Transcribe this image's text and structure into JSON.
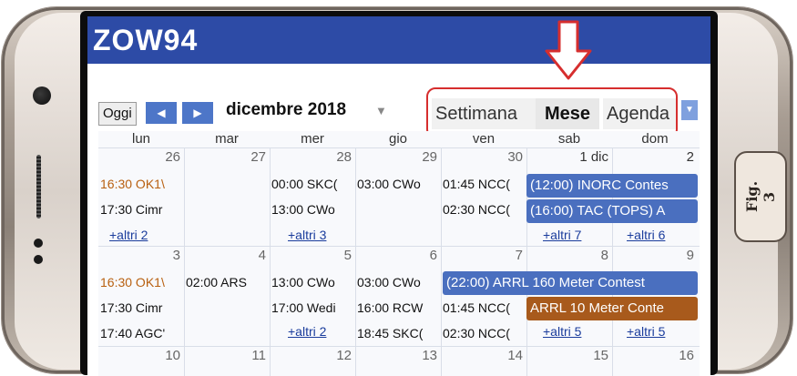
{
  "app": {
    "title": "ZOW94"
  },
  "toolbar": {
    "today_label": "Oggi",
    "prev_label": "◀",
    "next_label": "▶",
    "month_label": "dicembre 2018",
    "views": [
      {
        "label": "Settimana",
        "active": false
      },
      {
        "label": "Mese",
        "active": true
      },
      {
        "label": "Agenda",
        "active": false
      }
    ]
  },
  "weekdays": [
    "lun",
    "mar",
    "mer",
    "gio",
    "ven",
    "sab",
    "dom"
  ],
  "weeks": [
    {
      "days": [
        "26",
        "27",
        "28",
        "29",
        "30",
        "1 dic",
        "2"
      ],
      "events": [
        [
          "16:30 OK1\\",
          "",
          "00:00 SKC(",
          "03:00 CWo",
          "01:45 NCC(",
          "",
          ""
        ],
        [
          "17:30 Cimr",
          "",
          "13:00 CWo",
          "",
          "02:30 NCC(",
          "",
          ""
        ]
      ],
      "more": [
        "+altri 2",
        "",
        "+altri 3",
        "",
        "",
        "+altri 7",
        "+altri 6"
      ],
      "bars": [
        {
          "text": "(12:00) INORC Contes",
          "color": "#4a6fbf"
        },
        {
          "text": "(16:00) TAC (TOPS) A",
          "color": "#4a6fbf"
        }
      ]
    },
    {
      "days": [
        "3",
        "4",
        "5",
        "6",
        "7",
        "8",
        "9"
      ],
      "events": [
        [
          "16:30 OK1\\",
          "02:00 ARS",
          "13:00 CWo",
          "03:00 CWo",
          "",
          "",
          ""
        ],
        [
          "17:30 Cimr",
          "",
          "17:00 Wedi",
          "16:00 RCW",
          "01:45 NCC(",
          "",
          ""
        ],
        [
          "17:40 AGC'",
          "",
          "",
          "18:45 SKC(",
          "02:30 NCC(",
          "",
          ""
        ]
      ],
      "more": [
        "",
        "",
        "+altri 2",
        "",
        "",
        "+altri 5",
        "+altri 5"
      ],
      "bars": [
        {
          "text": "(22:00) ARRL 160 Meter Contest",
          "color": "#4a6fbf"
        },
        {
          "text": "ARRL 10 Meter Conte",
          "color": "#a85a1c"
        }
      ]
    },
    {
      "days": [
        "10",
        "11",
        "12",
        "13",
        "14",
        "15",
        "16"
      ]
    }
  ],
  "figure": {
    "label": "Fig. 3"
  },
  "colors": {
    "appbar": "#2d4ba6",
    "highlight": "#d62e2e",
    "event_blue": "#4a6fbf",
    "event_brown": "#a85a1c"
  }
}
